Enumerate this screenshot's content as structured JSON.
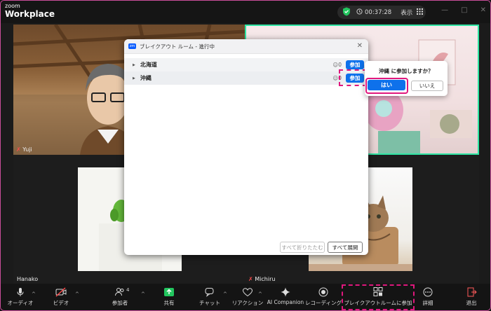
{
  "app": {
    "brand_top": "zoom",
    "brand_main": "Workplace"
  },
  "titlebar": {
    "timer": "00:37:28",
    "view_label": "表示"
  },
  "participants": {
    "yuji": "Yuji",
    "hanako": "Hanako",
    "michiru": "Michiru"
  },
  "breakout_dialog": {
    "title": "ブレイクアウト ルーム - 進行中",
    "logo_text": "zm",
    "rooms": [
      {
        "name": "北海道",
        "count": "0",
        "join_label": "参加"
      },
      {
        "name": "沖縄",
        "count": "0",
        "join_label": "参加"
      }
    ],
    "collapse_all": "すべて折りたたむ",
    "expand_all": "すべて展開"
  },
  "confirm_popover": {
    "question": "沖縄 に参加しますか？",
    "yes": "はい",
    "no": "いいえ"
  },
  "toolbar": {
    "audio": "オーディオ",
    "video": "ビデオ",
    "participants": "参加者",
    "participants_count": "4",
    "share": "共有",
    "chat": "チャット",
    "reactions": "リアクション",
    "ai_companion": "AI Companion",
    "recording": "レコーディング",
    "breakout": "ブレイクアウトルームに参加",
    "more": "詳細",
    "leave": "退出"
  },
  "colors": {
    "accent": "#0e71eb",
    "highlight": "#e0177d",
    "active_speaker": "#2ee6a4",
    "shield": "#22c55e"
  }
}
